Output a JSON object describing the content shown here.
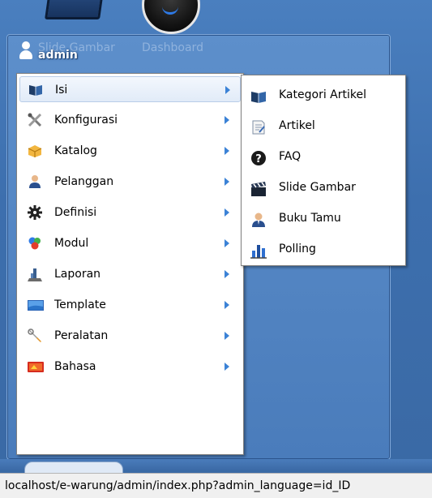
{
  "panel": {
    "username": "admin",
    "ghost_labels": [
      "Slide Gambar",
      "Dashboard"
    ]
  },
  "main_menu": {
    "items": [
      {
        "label": "Isi",
        "icon": "content-icon"
      },
      {
        "label": "Konfigurasi",
        "icon": "tools-icon"
      },
      {
        "label": "Katalog",
        "icon": "box-icon"
      },
      {
        "label": "Pelanggan",
        "icon": "user-icon"
      },
      {
        "label": "Definisi",
        "icon": "gear-icon"
      },
      {
        "label": "Modul",
        "icon": "modules-icon"
      },
      {
        "label": "Laporan",
        "icon": "report-icon"
      },
      {
        "label": "Template",
        "icon": "template-icon"
      },
      {
        "label": "Peralatan",
        "icon": "wrench-icon"
      },
      {
        "label": "Bahasa",
        "icon": "language-icon"
      }
    ]
  },
  "sub_menu": {
    "items": [
      {
        "label": "Kategori Artikel",
        "icon": "category-icon"
      },
      {
        "label": "Artikel",
        "icon": "article-icon"
      },
      {
        "label": "FAQ",
        "icon": "help-icon"
      },
      {
        "label": "Slide Gambar",
        "icon": "clapper-icon"
      },
      {
        "label": "Buku Tamu",
        "icon": "guestbook-icon"
      },
      {
        "label": "Polling",
        "icon": "chart-icon"
      }
    ]
  },
  "status_bar": {
    "url": "localhost/e-warung/admin/index.php?admin_language=id_ID"
  },
  "colors": {
    "desktop": "#3d6fae",
    "panel": "#5d8fcb",
    "arrow": "#3b82d6",
    "hover": "#e1ebf8"
  }
}
